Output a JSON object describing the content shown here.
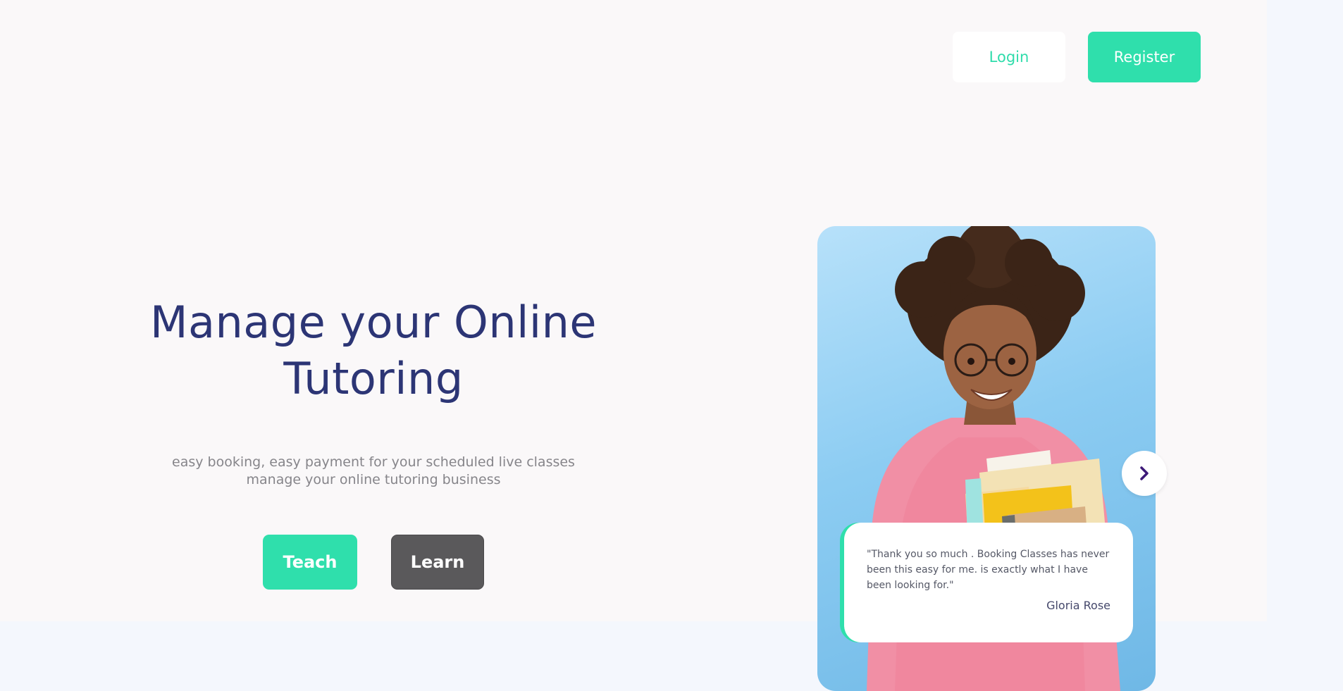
{
  "header": {
    "login_label": "Login",
    "register_label": "Register"
  },
  "hero": {
    "title_line1": "Manage your Online",
    "title_line2": "Tutoring",
    "subtitle_line1": "easy booking, easy payment for your scheduled live classes",
    "subtitle_line2": "manage your online tutoring business",
    "teach_label": "Teach",
    "learn_label": "Learn"
  },
  "testimonial": {
    "quote": "\"Thank you so much . Booking Classes has never been this easy for me. is exactly what I have been looking for.\"",
    "author": "Gloria Rose"
  },
  "icons": {
    "next": "chevron-right-icon"
  },
  "colors": {
    "accent": "#2fdfac",
    "headline": "#2c3575",
    "learn_button": "#5a595b",
    "chevron": "#3d1a78"
  }
}
